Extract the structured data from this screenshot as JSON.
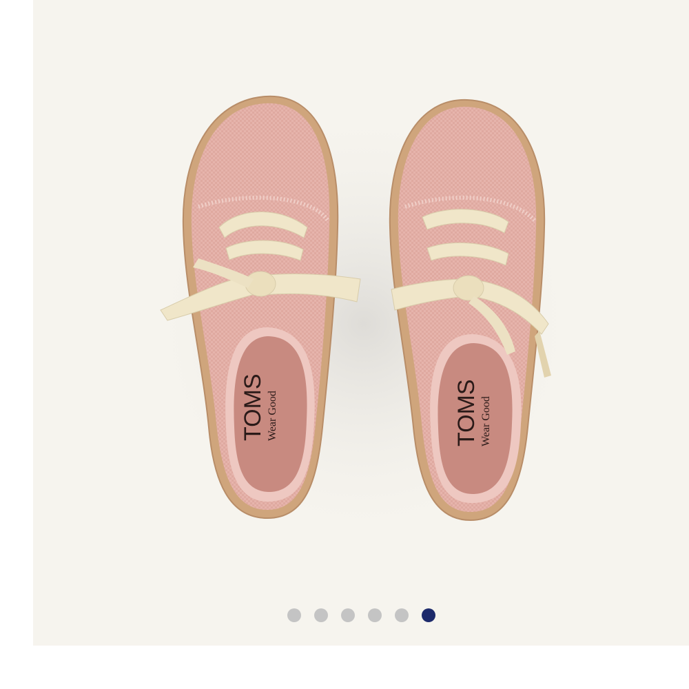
{
  "product": {
    "insole_brand": "TOMS",
    "insole_registered": "®",
    "insole_tagline": "Wear Good",
    "colors": {
      "canvas": "#e7b6ae",
      "insole": "#c88a80",
      "laces": "#f0e6c9",
      "jute": "#c9a27a",
      "background": "#f6f4ee"
    }
  },
  "carousel": {
    "total_slides": 6,
    "active_index": 5,
    "dot_color": "#c4c4c4",
    "active_dot_color": "#1d2a6b"
  }
}
